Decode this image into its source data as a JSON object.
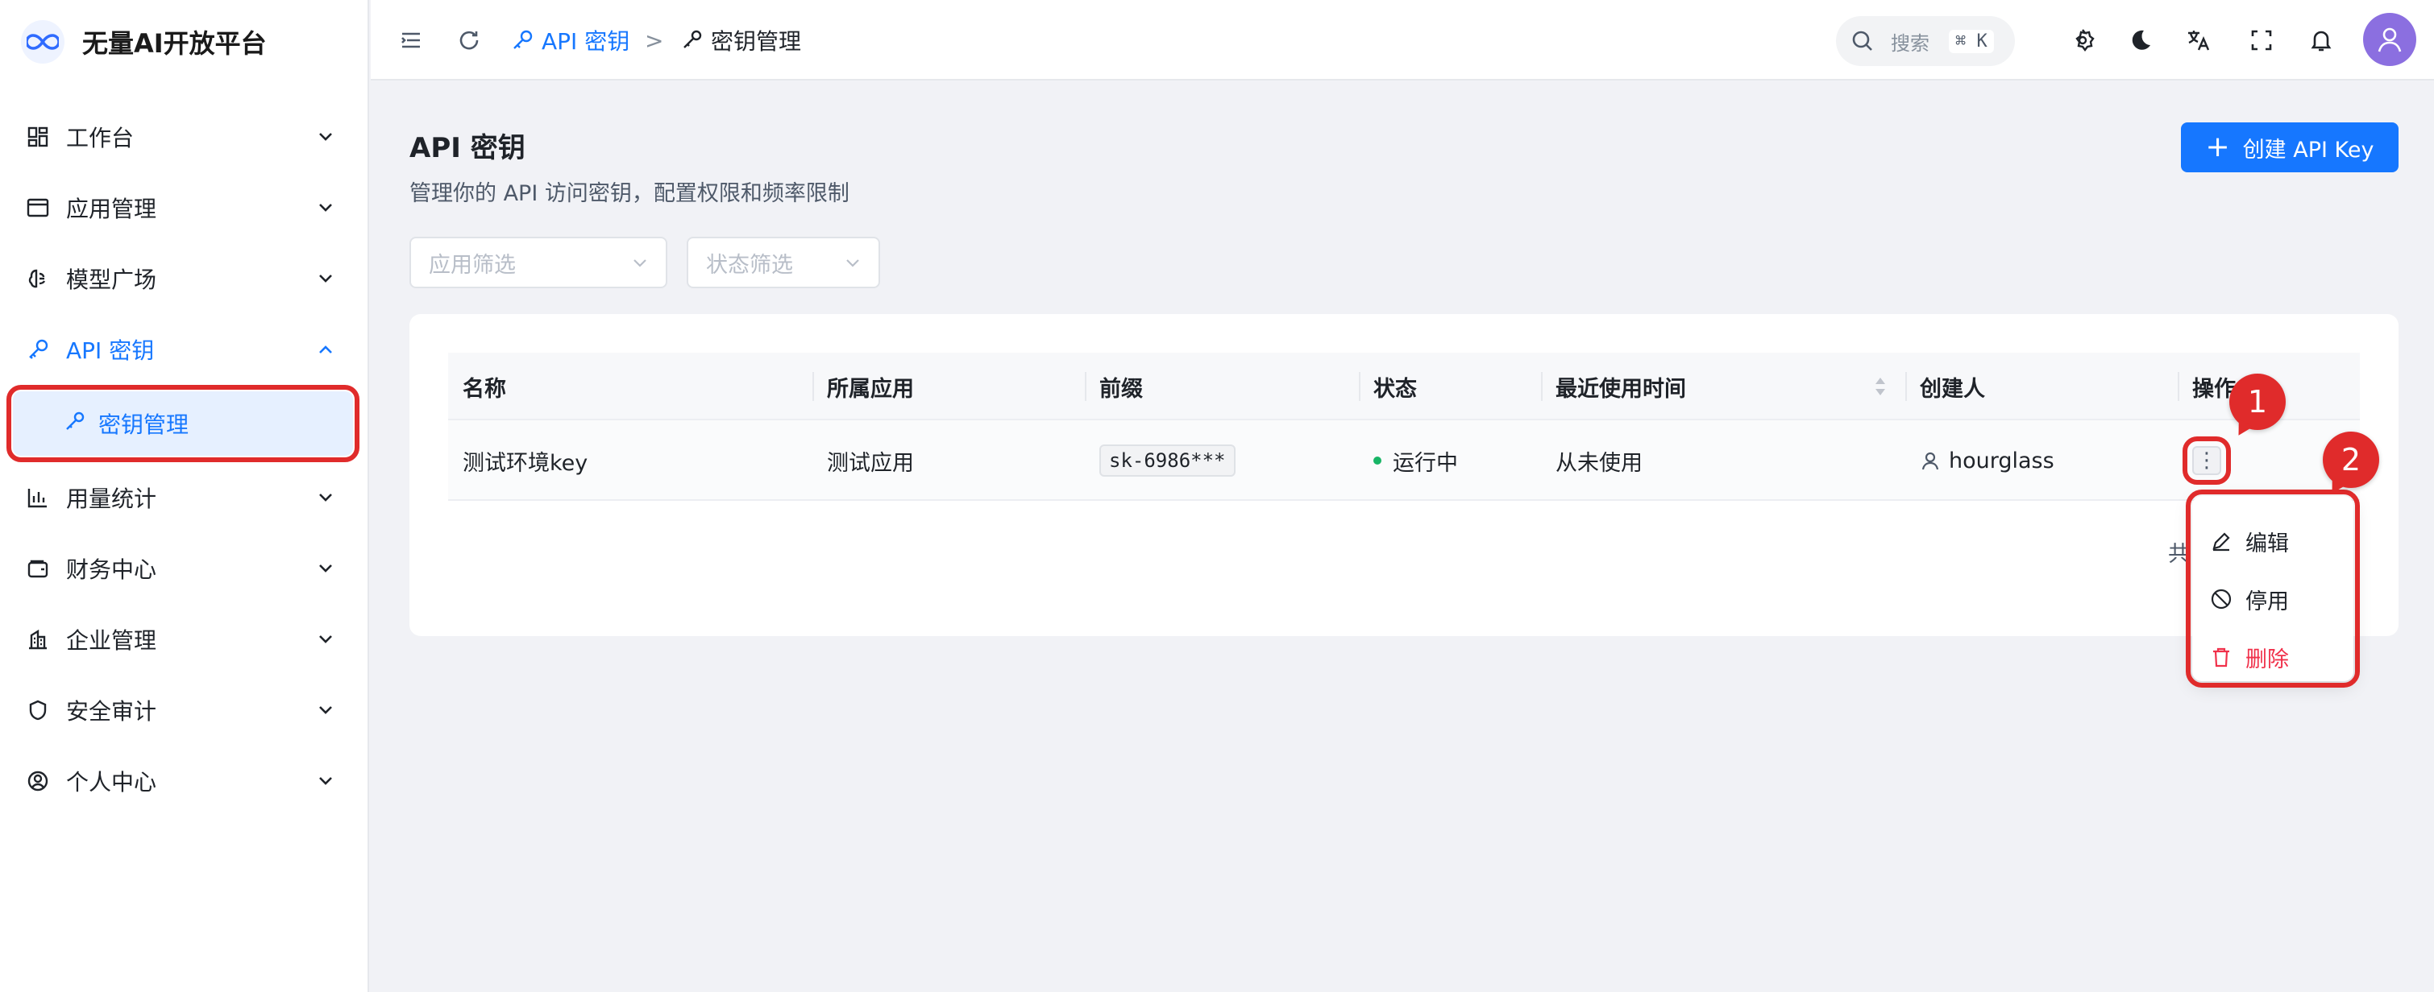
{
  "brand": {
    "name": "无量AI开放平台"
  },
  "sidebar": {
    "items": [
      {
        "label": "工作台",
        "icon": "dashboard-icon"
      },
      {
        "label": "应用管理",
        "icon": "app-window-icon"
      },
      {
        "label": "模型广场",
        "icon": "brain-icon"
      },
      {
        "label": "API 密钥",
        "icon": "key-icon",
        "expanded": true
      },
      {
        "label": "用量统计",
        "icon": "bar-chart-icon"
      },
      {
        "label": "财务中心",
        "icon": "wallet-icon"
      },
      {
        "label": "企业管理",
        "icon": "building-icon"
      },
      {
        "label": "安全审计",
        "icon": "shield-icon"
      },
      {
        "label": "个人中心",
        "icon": "user-circle-icon"
      }
    ],
    "subitem": {
      "label": "密钥管理",
      "icon": "key-icon"
    }
  },
  "header": {
    "breadcrumb": {
      "parent": "API 密钥",
      "current": "密钥管理",
      "separator": ">"
    },
    "search": {
      "placeholder": "搜索",
      "shortcut": "⌘ K"
    },
    "icons": [
      "menu-toggle-icon",
      "refresh-icon",
      "gear-icon",
      "moon-icon",
      "translate-icon",
      "fullscreen-icon",
      "bell-icon",
      "user-avatar-icon"
    ]
  },
  "page": {
    "title": "API 密钥",
    "description": "管理你的 API 访问密钥，配置权限和频率限制",
    "create_button": "创建 API Key",
    "filters": {
      "app_placeholder": "应用筛选",
      "status_placeholder": "状态筛选"
    }
  },
  "table": {
    "columns": [
      "名称",
      "所属应用",
      "前缀",
      "状态",
      "最近使用时间",
      "创建人",
      "操作"
    ],
    "rows": [
      {
        "name": "测试环境key",
        "app": "测试应用",
        "prefix": "sk-6986***",
        "status": "运行中",
        "last_used": "从未使用",
        "creator": "hourglass",
        "action": "⋮"
      }
    ],
    "total_label": "共"
  },
  "dropdown": {
    "items": [
      {
        "label": "编辑",
        "icon": "edit-icon"
      },
      {
        "label": "停用",
        "icon": "ban-icon"
      },
      {
        "label": "删除",
        "icon": "trash-icon",
        "danger": true
      }
    ]
  },
  "annotations": {
    "badge1": "1",
    "badge2": "2"
  },
  "colors": {
    "primary": "#1677ff",
    "annotation": "#e02b2b",
    "danger": "#f0304a",
    "success": "#18b566"
  }
}
